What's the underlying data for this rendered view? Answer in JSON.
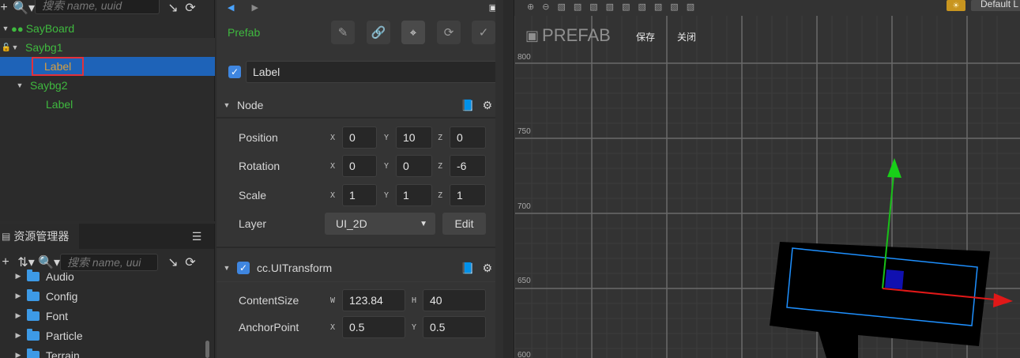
{
  "hierarchy": {
    "search_placeholder": "搜索 name, uuid",
    "nodes": [
      {
        "label": "SayBoard"
      },
      {
        "label": "Saybg1"
      },
      {
        "label": "Label"
      },
      {
        "label": "Saybg2"
      },
      {
        "label": "Label"
      }
    ]
  },
  "assets": {
    "tab_label": "资源管理器",
    "search_placeholder": "搜索 name, uui",
    "folders": [
      "Audio",
      "Config",
      "Font",
      "Particle",
      "Terrain"
    ]
  },
  "inspector": {
    "prefab_label": "Prefab",
    "node_name": "Label",
    "node_section": "Node",
    "position": {
      "label": "Position",
      "x": "0",
      "y": "10",
      "z": "0"
    },
    "rotation": {
      "label": "Rotation",
      "x": "0",
      "y": "0",
      "z": "-6"
    },
    "scale": {
      "label": "Scale",
      "x": "1",
      "y": "1",
      "z": "1"
    },
    "layer": {
      "label": "Layer",
      "value": "UI_2D",
      "edit": "Edit"
    },
    "uitransform_section": "cc.UITransform",
    "content_size": {
      "label": "ContentSize",
      "w": "123.84",
      "h": "40"
    },
    "anchor_point": {
      "label": "AnchorPoint",
      "x": "0.5",
      "y": "0.5"
    },
    "axis": {
      "x": "X",
      "y": "Y",
      "z": "Z",
      "w": "W",
      "h": "H"
    }
  },
  "scene": {
    "title": "PREFAB",
    "save": "保存",
    "close": "关闭",
    "default_btn": "Default L",
    "ruler": [
      "800",
      "750",
      "700",
      "650",
      "600"
    ]
  },
  "colors": {
    "accent_blue": "#1e63b8",
    "node_green": "#3fb93f",
    "highlight_red": "#e2313c",
    "label_gold": "#d9a03f"
  }
}
